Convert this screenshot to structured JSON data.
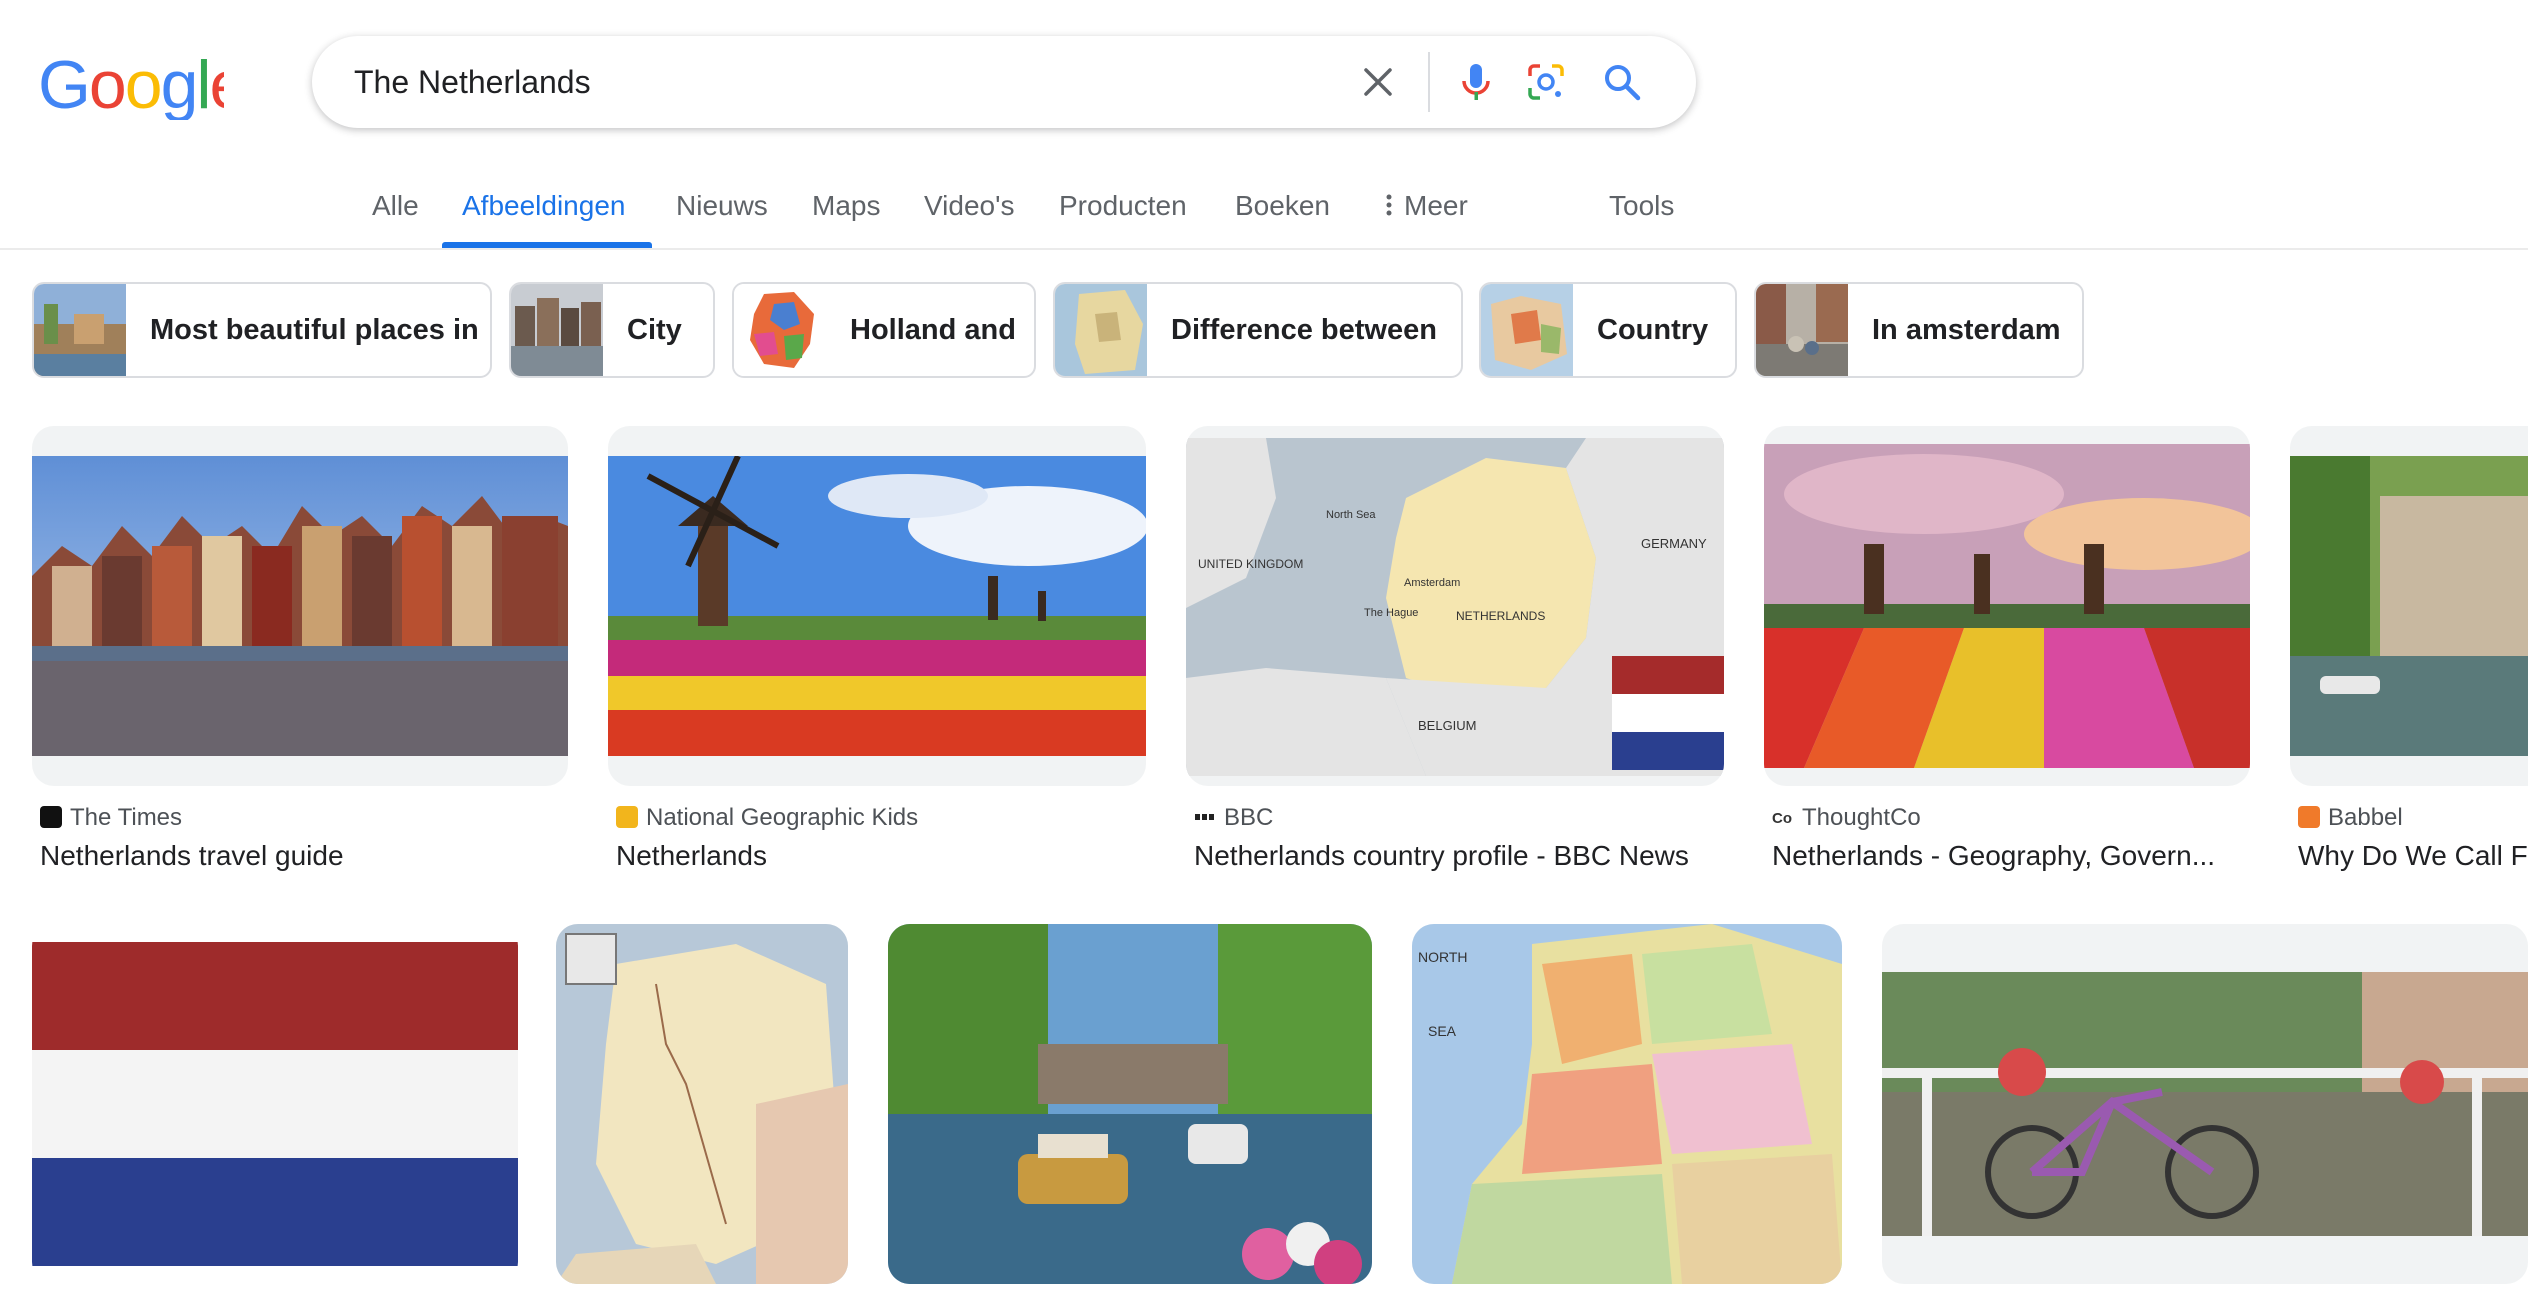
{
  "search": {
    "query": "The Netherlands"
  },
  "logo": {
    "text": "Google"
  },
  "tabs": [
    {
      "label": "Alle"
    },
    {
      "label": "Afbeeldingen",
      "active": true
    },
    {
      "label": "Nieuws"
    },
    {
      "label": "Maps"
    },
    {
      "label": "Video's"
    },
    {
      "label": "Producten"
    },
    {
      "label": "Boeken"
    },
    {
      "label": "Meer"
    },
    {
      "label": "Tools"
    }
  ],
  "chips": [
    {
      "label": "Most beautiful places in"
    },
    {
      "label": "City"
    },
    {
      "label": "Holland and"
    },
    {
      "label": "Difference between"
    },
    {
      "label": "Country"
    },
    {
      "label": "In amsterdam"
    }
  ],
  "results": [
    {
      "source": "The Times",
      "title": "Netherlands travel guide"
    },
    {
      "source": "National Geographic Kids",
      "title": "Netherlands"
    },
    {
      "source": "BBC",
      "title": "Netherlands country profile - BBC News"
    },
    {
      "source": "ThoughtCo",
      "title": "Netherlands - Geography, Govern..."
    },
    {
      "source": "Babbel",
      "title": "Why Do We Call F"
    }
  ],
  "map_labels": {
    "united_kingdom": "UNITED KINGDOM",
    "north_sea": "North Sea",
    "germany": "GERMANY",
    "amsterdam": "Amsterdam",
    "the_hague": "The Hague",
    "netherlands": "NETHERLANDS",
    "belgium": "BELGIUM",
    "north": "NORTH",
    "sea": "SEA"
  },
  "colors": {
    "accent": "#1a73e8",
    "flag_red": "#9e2b2b",
    "flag_white": "#f4f4f4",
    "flag_blue": "#2a3f8f"
  }
}
